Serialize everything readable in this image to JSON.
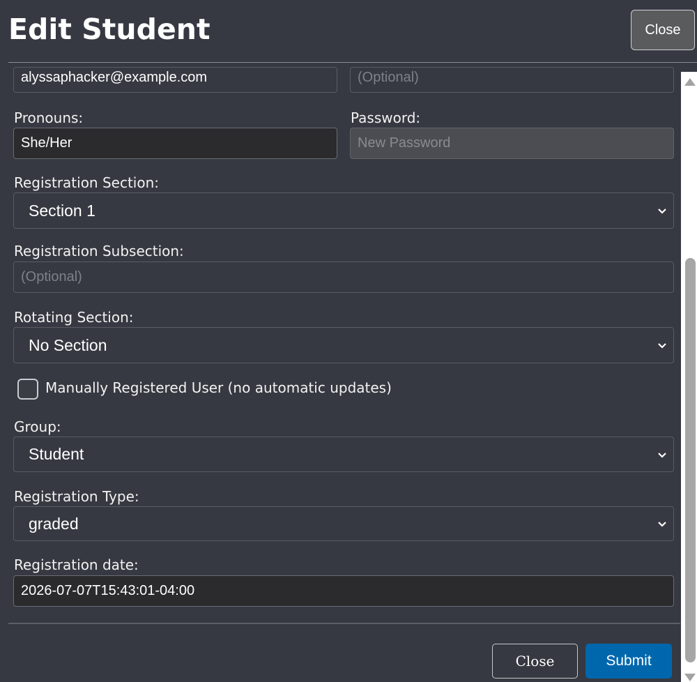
{
  "header": {
    "title": "Edit Student",
    "close_label": "Close"
  },
  "fields": {
    "email_value": "alyssaphacker@example.com",
    "secondary_placeholder": "(Optional)",
    "pronouns_label": "Pronouns:",
    "pronouns_value": "She/Her",
    "password_label": "Password:",
    "password_placeholder": "New Password",
    "registration_section_label": "Registration Section:",
    "registration_section_value": "Section 1",
    "registration_subsection_label": "Registration Subsection:",
    "registration_subsection_placeholder": "(Optional)",
    "rotating_section_label": "Rotating Section:",
    "rotating_section_value": "No Section",
    "manual_label": "Manually Registered User (no automatic updates)",
    "group_label": "Group:",
    "group_value": "Student",
    "registration_type_label": "Registration Type:",
    "registration_type_value": "graded",
    "registration_date_label": "Registration date:",
    "registration_date_value": "2026-07-07T15:43:01-04:00"
  },
  "footer": {
    "close_label": "Close",
    "submit_label": "Submit"
  },
  "colors": {
    "background": "#363941",
    "submit": "#0067ad"
  }
}
